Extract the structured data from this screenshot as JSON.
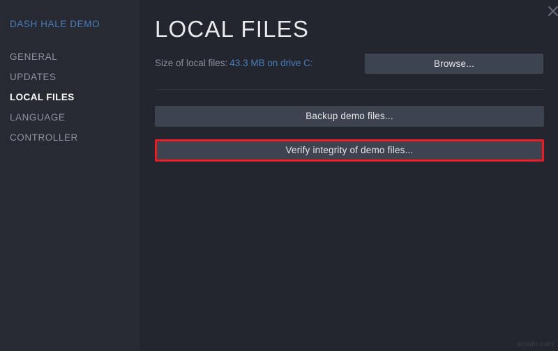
{
  "window": {
    "close_icon": "close-icon"
  },
  "sidebar": {
    "title": "DASH HALE DEMO",
    "items": [
      {
        "label": "GENERAL",
        "active": false
      },
      {
        "label": "UPDATES",
        "active": false
      },
      {
        "label": "LOCAL FILES",
        "active": true
      },
      {
        "label": "LANGUAGE",
        "active": false
      },
      {
        "label": "CONTROLLER",
        "active": false
      }
    ]
  },
  "main": {
    "title": "LOCAL FILES",
    "size_label": "Size of local files:",
    "size_value": "43.3 MB on drive C:",
    "browse_button": "Browse...",
    "backup_button": "Backup demo files...",
    "verify_button": "Verify integrity of demo files..."
  },
  "annotation": {
    "highlight_color": "#ee1b24",
    "target": "verify-integrity-button"
  },
  "colors": {
    "sidebar_bg": "#272a33",
    "content_bg": "#23262e",
    "button_bg": "#3d4450",
    "accent_blue": "#4a7ebb",
    "text_muted": "#8b909c",
    "text_bright": "#ffffff"
  },
  "watermark": {
    "text": "wsxdn.com"
  }
}
